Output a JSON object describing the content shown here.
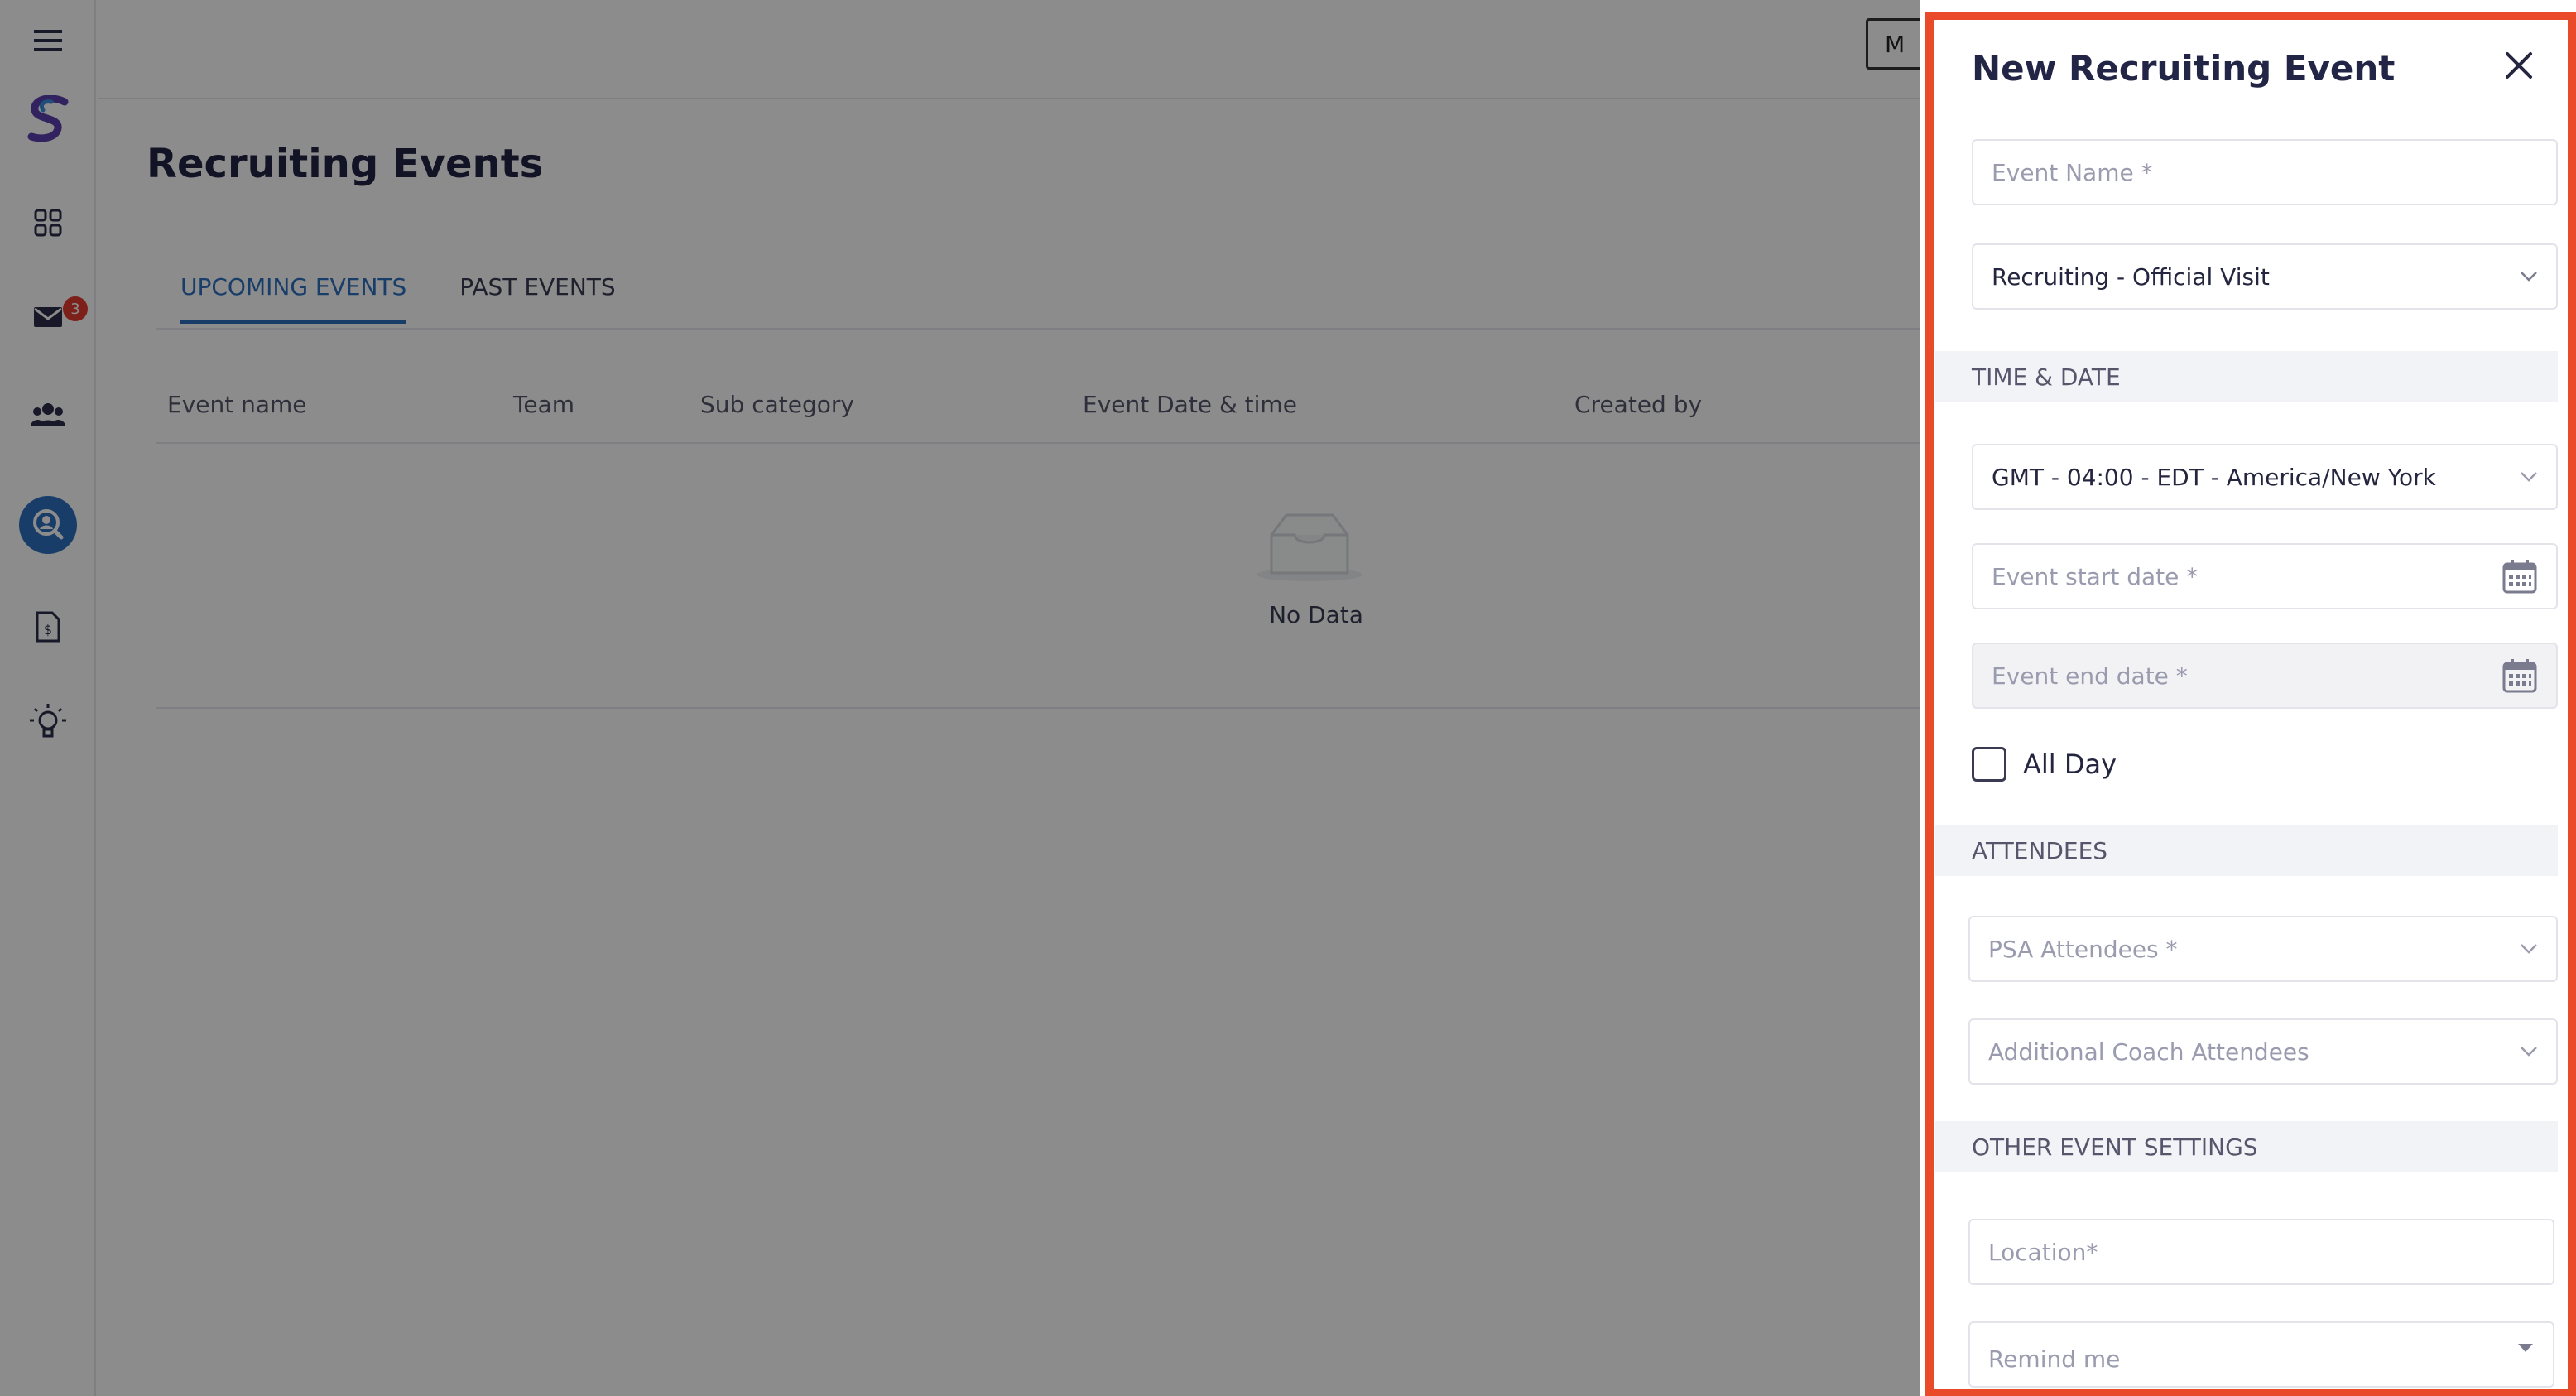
{
  "sidebar": {
    "items": [
      {
        "icon": "menu-icon"
      },
      {
        "icon": "logo-icon"
      },
      {
        "icon": "dashboard-icon"
      },
      {
        "icon": "mail-icon",
        "badge": "3"
      },
      {
        "icon": "team-icon"
      },
      {
        "icon": "recruiting-search-icon"
      },
      {
        "icon": "document-icon"
      },
      {
        "icon": "lightbulb-icon"
      }
    ]
  },
  "topbar": {
    "button_label": "M"
  },
  "page": {
    "title": "Recruiting Events",
    "tabs": [
      {
        "label": "UPCOMING EVENTS",
        "active": true
      },
      {
        "label": "PAST EVENTS",
        "active": false
      }
    ],
    "table": {
      "columns": [
        "Event name",
        "Team",
        "Sub category",
        "Event Date & time",
        "Created by"
      ],
      "empty_text": "No Data"
    }
  },
  "drawer": {
    "title": "New Recruiting Event",
    "event_name_placeholder": "Event Name *",
    "event_type_value": "Recruiting - Official Visit",
    "sections": {
      "time_date": "TIME & DATE",
      "attendees": "ATTENDEES",
      "other": "OTHER EVENT SETTINGS"
    },
    "timezone_value": "GMT - 04:00 - EDT - America/New York",
    "start_date_placeholder": "Event start date *",
    "end_date_placeholder": "Event end date *",
    "all_day_label": "All Day",
    "psa_attendees_placeholder": "PSA Attendees *",
    "coach_attendees_placeholder": "Additional Coach Attendees",
    "location_placeholder": "Location*",
    "remind_placeholder": "Remind me"
  },
  "colors": {
    "accent": "#2d6fc0",
    "highlight_border": "#e84a2a",
    "badge": "#e33b2e",
    "title": "#222545"
  }
}
